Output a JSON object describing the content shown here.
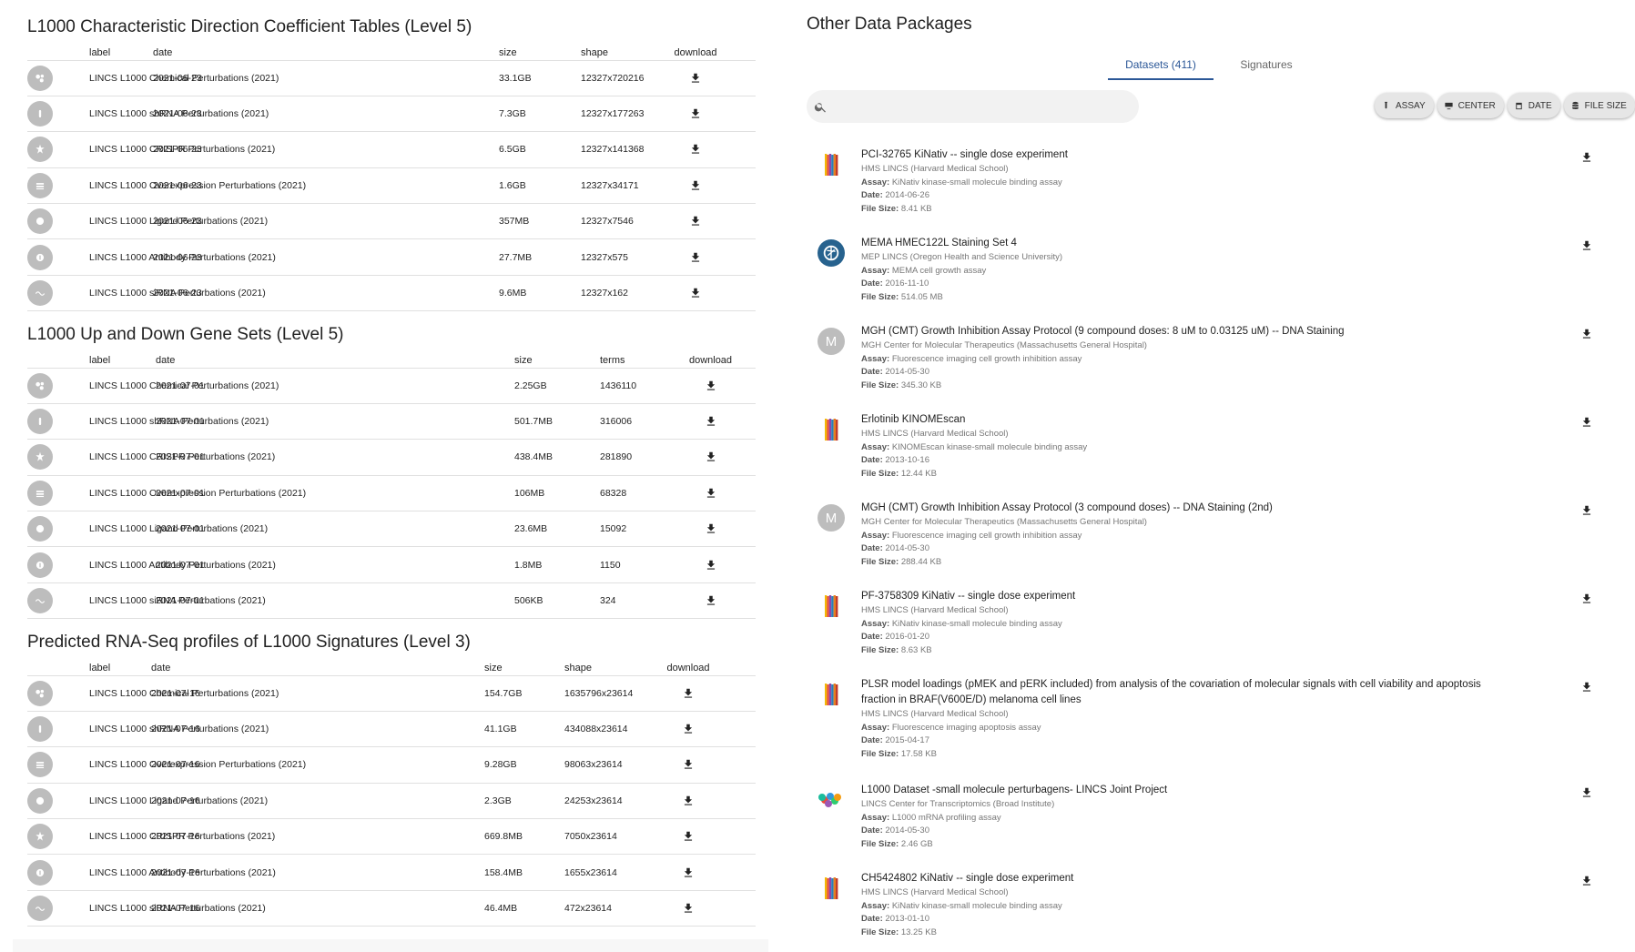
{
  "left": {
    "sections": [
      {
        "title": "L1000 Characteristic Direction Coefficient Tables (Level 5)",
        "columns": [
          "label",
          "date",
          "size",
          "shape",
          "download"
        ],
        "rows": [
          {
            "icon": "chemical-icon",
            "label": "LINCS L1000 Chemical Perturbations (2021)",
            "date": "2021-06-23",
            "size": "33.1GB",
            "extra": "12327x720216"
          },
          {
            "icon": "shrna-icon",
            "label": "LINCS L1000 shRNA Perturbations (2021)",
            "date": "2021-06-23",
            "size": "7.3GB",
            "extra": "12327x177263"
          },
          {
            "icon": "crispr-icon",
            "label": "LINCS L1000 CRISPR Perturbations (2021)",
            "date": "2021-06-23",
            "size": "6.5GB",
            "extra": "12327x141368"
          },
          {
            "icon": "overexpression-icon",
            "label": "LINCS L1000 Overexpression Perturbations (2021)",
            "date": "2021-06-23",
            "size": "1.6GB",
            "extra": "12327x34171"
          },
          {
            "icon": "ligand-icon",
            "label": "LINCS L1000 Ligand Perturbations (2021)",
            "date": "2021-06-23",
            "size": "357MB",
            "extra": "12327x7546"
          },
          {
            "icon": "antibody-icon",
            "label": "LINCS L1000 Antibody Perturbations (2021)",
            "date": "2021-06-23",
            "size": "27.7MB",
            "extra": "12327x575"
          },
          {
            "icon": "sirna-icon",
            "label": "LINCS L1000 siRNA Perturbations (2021)",
            "date": "2021-06-23",
            "size": "9.6MB",
            "extra": "12327x162"
          }
        ]
      },
      {
        "title": "L1000 Up and Down Gene Sets (Level 5)",
        "columns": [
          "label",
          "date",
          "size",
          "terms",
          "download"
        ],
        "rows": [
          {
            "icon": "chemical-icon",
            "label": "LINCS L1000 Chemical Perturbations (2021)",
            "date": "2021-07-01",
            "size": "2.25GB",
            "extra": "1436110"
          },
          {
            "icon": "shrna-icon",
            "label": "LINCS L1000 shRNA Perturbations (2021)",
            "date": "2021-07-01",
            "size": "501.7MB",
            "extra": "316006"
          },
          {
            "icon": "crispr-icon",
            "label": "LINCS L1000 CRISPR Perturbations (2021)",
            "date": "2021-07-01",
            "size": "438.4MB",
            "extra": "281890"
          },
          {
            "icon": "overexpression-icon",
            "label": "LINCS L1000 Overexpression Perturbations (2021)",
            "date": "2021-07-01",
            "size": "106MB",
            "extra": "68328"
          },
          {
            "icon": "ligand-icon",
            "label": "LINCS L1000 Ligand Perturbations (2021)",
            "date": "2021-07-01",
            "size": "23.6MB",
            "extra": "15092"
          },
          {
            "icon": "antibody-icon",
            "label": "LINCS L1000 Antibody Perturbations (2021)",
            "date": "2021-07-01",
            "size": "1.8MB",
            "extra": "1150"
          },
          {
            "icon": "sirna-icon",
            "label": "LINCS L1000 siRNA Perturbations (2021)",
            "date": "2021-07-01",
            "size": "506KB",
            "extra": "324"
          }
        ]
      },
      {
        "title": "Predicted RNA-Seq profiles of L1000 Signatures (Level 3)",
        "columns": [
          "label",
          "date",
          "size",
          "shape",
          "download"
        ],
        "rows": [
          {
            "icon": "chemical-icon",
            "label": "LINCS L1000 Chemical Perturbations (2021)",
            "date": "2021-07-16",
            "size": "154.7GB",
            "extra": "1635796x23614"
          },
          {
            "icon": "shrna-icon",
            "label": "LINCS L1000 shRNA Perturbations (2021)",
            "date": "2021-07-16",
            "size": "41.1GB",
            "extra": "434088x23614"
          },
          {
            "icon": "overexpression-icon",
            "label": "LINCS L1000 Overexpression Perturbations (2021)",
            "date": "2021-07-16",
            "size": "9.28GB",
            "extra": "98063x23614"
          },
          {
            "icon": "ligand-icon",
            "label": "LINCS L1000 Ligand Perturbations (2021)",
            "date": "2021-07-16",
            "size": "2.3GB",
            "extra": "24253x23614"
          },
          {
            "icon": "crispr-icon",
            "label": "LINCS L1000 CRISPR Perturbations (2021)",
            "date": "2021-07-16",
            "size": "669.8MB",
            "extra": "7050x23614"
          },
          {
            "icon": "antibody-icon",
            "label": "LINCS L1000 Antibody Perturbations (2021)",
            "date": "2021-07-16",
            "size": "158.4MB",
            "extra": "1655x23614"
          },
          {
            "icon": "sirna-icon",
            "label": "LINCS L1000 siRNA Perturbations (2021)",
            "date": "2021-07-16",
            "size": "46.4MB",
            "extra": "472x23614"
          }
        ]
      }
    ]
  },
  "right": {
    "title": "Other Data Packages",
    "tabs": [
      "Datasets (411)",
      "Signatures"
    ],
    "search": {
      "placeholder": "",
      "value": ""
    },
    "filters": [
      {
        "label": "ASSAY",
        "icon": "assay-icon"
      },
      {
        "label": "CENTER",
        "icon": "center-icon"
      },
      {
        "label": "DATE",
        "icon": "calendar-icon"
      },
      {
        "label": "FILE SIZE",
        "icon": "database-icon"
      }
    ],
    "labels": {
      "assay": "Assay:",
      "date": "Date:",
      "file_size": "File Size:"
    },
    "datasets": [
      {
        "icon": "hms-logo",
        "title": "PCI-32765 KiNativ -- single dose experiment",
        "center": "HMS LINCS (Harvard Medical School)",
        "assay": "KiNativ kinase-small molecule binding assay",
        "date": "2014-06-26",
        "file_size": "8.41 KB"
      },
      {
        "icon": "mep-logo",
        "title": "MEMA HMEC122L Staining Set 4",
        "center": "MEP LINCS (Oregon Health and Science University)",
        "assay": "MEMA cell growth assay",
        "date": "2016-11-10",
        "file_size": "514.05 MB"
      },
      {
        "icon": "m-avatar",
        "avatar_letter": "M",
        "title": "MGH (CMT) Growth Inhibition Assay Protocol (9 compound doses: 8 uM to 0.03125 uM) -- DNA Staining",
        "center": "MGH Center for Molecular Therapeutics (Massachusetts General Hospital)",
        "assay": "Fluorescence imaging cell growth inhibition assay",
        "date": "2014-05-30",
        "file_size": "345.30 KB"
      },
      {
        "icon": "hms-logo",
        "title": "Erlotinib KINOMEscan",
        "center": "HMS LINCS (Harvard Medical School)",
        "assay": "KINOMEscan kinase-small molecule binding assay",
        "date": "2013-10-16",
        "file_size": "12.44 KB"
      },
      {
        "icon": "m-avatar",
        "avatar_letter": "M",
        "title": "MGH (CMT) Growth Inhibition Assay Protocol (3 compound doses) -- DNA Staining (2nd)",
        "center": "MGH Center for Molecular Therapeutics (Massachusetts General Hospital)",
        "assay": "Fluorescence imaging cell growth inhibition assay",
        "date": "2014-05-30",
        "file_size": "288.44 KB"
      },
      {
        "icon": "hms-logo",
        "title": "PF-3758309 KiNativ -- single dose experiment",
        "center": "HMS LINCS (Harvard Medical School)",
        "assay": "KiNativ kinase-small molecule binding assay",
        "date": "2016-01-20",
        "file_size": "8.63 KB"
      },
      {
        "icon": "hms-logo",
        "title": "PLSR model loadings (pMEK and pERK included) from analysis of the covariation of molecular signals with cell viability and apoptosis fraction in BRAF(V600E/D) melanoma cell lines",
        "center": "HMS LINCS (Harvard Medical School)",
        "assay": "Fluorescence imaging apoptosis assay",
        "date": "2015-04-17",
        "file_size": "17.58 KB"
      },
      {
        "icon": "broad-logo",
        "title": "L1000 Dataset -small molecule perturbagens- LINCS Joint Project",
        "center": "LINCS Center for Transcriptomics (Broad Institute)",
        "assay": "L1000 mRNA profiling assay",
        "date": "2014-05-30",
        "file_size": "2.46 GB"
      },
      {
        "icon": "hms-logo",
        "title": "CH5424802 KiNativ -- single dose experiment",
        "center": "HMS LINCS (Harvard Medical School)",
        "assay": "KiNativ kinase-small molecule binding assay",
        "date": "2013-01-10",
        "file_size": "13.25 KB"
      }
    ]
  }
}
